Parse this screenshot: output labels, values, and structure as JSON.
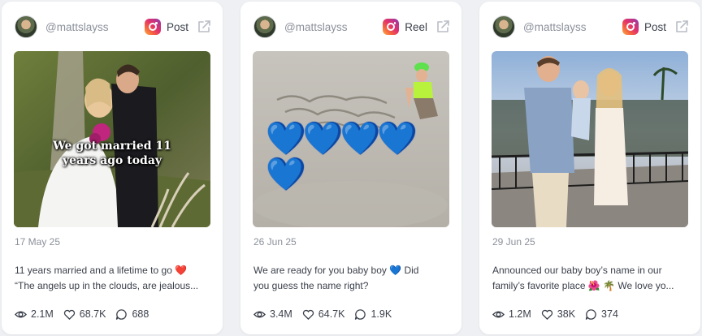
{
  "posts": [
    {
      "handle": "@mattslayss",
      "post_type": "Post",
      "icon": "instagram-icon",
      "overlay_text": "We got married 11 years ago today",
      "date": "17 May 25",
      "caption_line1": "11 years married and a lifetime to go ❤️",
      "caption_line2": "“The angels up in the clouds, are jealous...",
      "views": "2.1M",
      "likes": "68.7K",
      "comments": "688"
    },
    {
      "handle": "@mattslayss",
      "post_type": "Reel",
      "icon": "instagram-icon",
      "overlay_text": "💙💙💙💙💙",
      "date": "26 Jun 25",
      "caption_line1": "We are ready for you baby boy 💙 Did",
      "caption_line2": "you guess the name right?",
      "views": "3.4M",
      "likes": "64.7K",
      "comments": "1.9K"
    },
    {
      "handle": "@mattslayss",
      "post_type": "Post",
      "icon": "instagram-icon",
      "date": "29 Jun 25",
      "caption_line1": "Announced our baby boy’s name in our",
      "caption_line2": "family’s favorite place 🌺 🌴 We love yo...",
      "views": "1.2M",
      "likes": "38K",
      "comments": "374"
    }
  ],
  "colors": {
    "heart": "#1e63ff",
    "muted": "#8b909a",
    "text": "#3a3f4a"
  }
}
